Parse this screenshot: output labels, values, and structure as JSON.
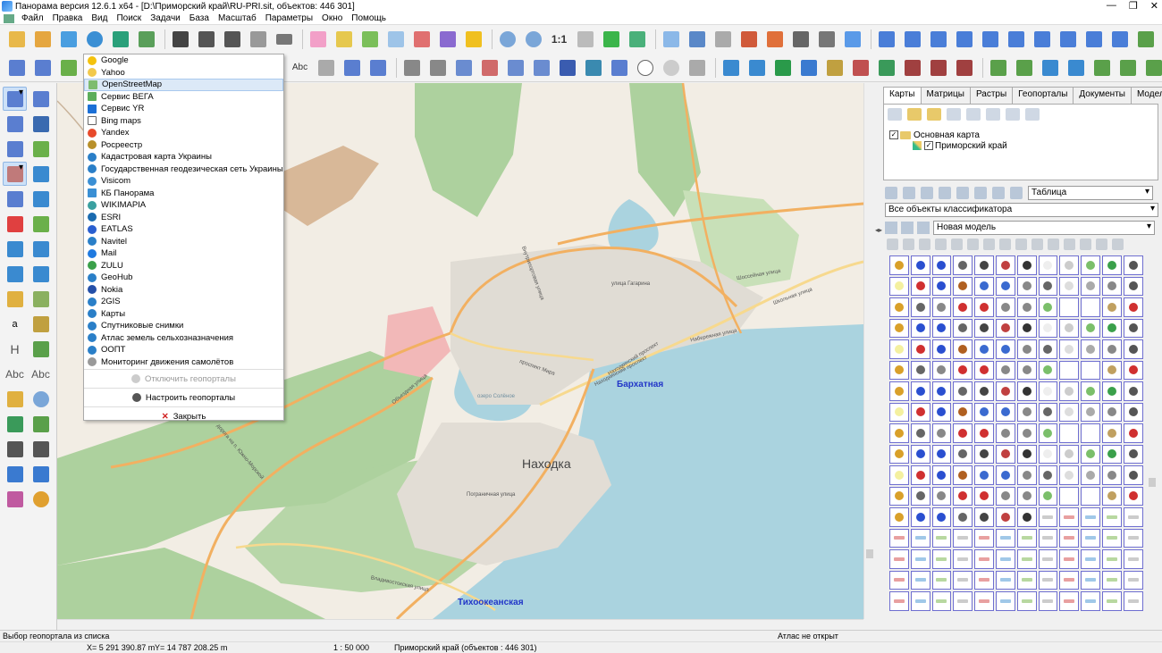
{
  "window": {
    "title": "Панорама версия 12.6.1 x64 - [D:\\Приморский край\\RU-PRI.sit, объектов: 446 301]"
  },
  "menu": [
    "Файл",
    "Правка",
    "Вид",
    "Поиск",
    "Задачи",
    "База",
    "Масштаб",
    "Параметры",
    "Окно",
    "Помощь"
  ],
  "toolbar": {
    "scale_label": "1:1",
    "text_label": "Abc"
  },
  "left_toolbar": {
    "h_label": "H",
    "abc1": "Abc",
    "abc2": "Abc",
    "a_label": "a"
  },
  "dropdown": {
    "items": [
      "Google",
      "Yahoo",
      "OpenStreetMap",
      "Сервис ВЕГА",
      "Сервис YR",
      "Bing maps",
      "Yandex",
      "Росреестр",
      "Кадастровая карта Украины",
      "Государственная геодезическая сеть Украины",
      "Visicom",
      "КБ Панорама",
      "WIKIMAPIA",
      "ESRI",
      "EATLAS",
      "Navitel",
      "Mail",
      "ZULU",
      "GeoHub",
      "Nokia",
      "2GIS",
      "Карты",
      "Спутниковые снимки",
      "Атлас земель сельхозназначения",
      "ООПТ",
      "Мониторинг движения самолётов"
    ],
    "selected": "OpenStreetMap",
    "disable_label": "Отключить геопорталы",
    "configure_label": "Настроить геопорталы",
    "close_label": "Закрыть"
  },
  "map": {
    "city": "Находка",
    "labels": [
      "Бархатная",
      "Тихоокеанская",
      "Находкинский проспект",
      "Находкинский проспект",
      "Набережная улица",
      "Школьная улица",
      "проспект Мира",
      "Пограничная улица",
      "Владивостокская улица",
      "Объездная улица",
      "дорога на п. Южно-Морской",
      "озеро Солёное",
      "Внутрипортовая улица",
      "Шоссейная улица",
      "улица Гагарина"
    ]
  },
  "panel": {
    "tabs": [
      "Карты",
      "Матрицы",
      "Растры",
      "Геопорталы",
      "Документы",
      "Модели"
    ],
    "active_tab": "Карты",
    "tree_root": "Основная карта",
    "tree_child": "Приморский край",
    "view_select": "Таблица",
    "classifier_select": "Все объекты классификатора",
    "model_select": "Новая модель"
  },
  "status": {
    "hint": "Выбор геопортала из списка",
    "atlas": "Атлас не открыт",
    "x": "X= 5 291 390.87 m",
    "y": "Y= 14 787 208.25 m",
    "scale": "1 : 50 000",
    "map_info": "Приморский край  (объектов : 446 301)"
  }
}
